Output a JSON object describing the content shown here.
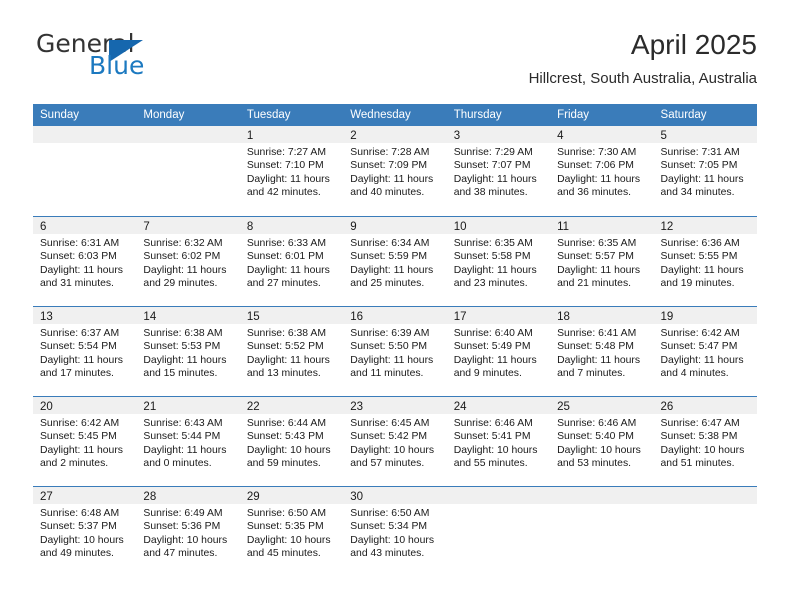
{
  "brand": {
    "name_part1": "General",
    "name_part2": "Blue",
    "triangle_icon": "triangle-icon",
    "color_primary": "#1c79c0",
    "color_dark": "#333333"
  },
  "header": {
    "title": "April 2025",
    "subtitle": "Hillcrest, South Australia, Australia"
  },
  "calendar": {
    "header_bg": "#3a7cba",
    "header_text_color": "#ffffff",
    "day_band_bg": "#f0f0f0",
    "weekdays": [
      "Sunday",
      "Monday",
      "Tuesday",
      "Wednesday",
      "Thursday",
      "Friday",
      "Saturday"
    ],
    "weeks": [
      [
        {
          "day": "",
          "empty": true
        },
        {
          "day": "",
          "empty": true
        },
        {
          "day": "1",
          "sunrise": "Sunrise: 7:27 AM",
          "sunset": "Sunset: 7:10 PM",
          "daylight_line1": "Daylight: 11 hours",
          "daylight_line2": "and 42 minutes."
        },
        {
          "day": "2",
          "sunrise": "Sunrise: 7:28 AM",
          "sunset": "Sunset: 7:09 PM",
          "daylight_line1": "Daylight: 11 hours",
          "daylight_line2": "and 40 minutes."
        },
        {
          "day": "3",
          "sunrise": "Sunrise: 7:29 AM",
          "sunset": "Sunset: 7:07 PM",
          "daylight_line1": "Daylight: 11 hours",
          "daylight_line2": "and 38 minutes."
        },
        {
          "day": "4",
          "sunrise": "Sunrise: 7:30 AM",
          "sunset": "Sunset: 7:06 PM",
          "daylight_line1": "Daylight: 11 hours",
          "daylight_line2": "and 36 minutes."
        },
        {
          "day": "5",
          "sunrise": "Sunrise: 7:31 AM",
          "sunset": "Sunset: 7:05 PM",
          "daylight_line1": "Daylight: 11 hours",
          "daylight_line2": "and 34 minutes."
        }
      ],
      [
        {
          "day": "6",
          "sunrise": "Sunrise: 6:31 AM",
          "sunset": "Sunset: 6:03 PM",
          "daylight_line1": "Daylight: 11 hours",
          "daylight_line2": "and 31 minutes."
        },
        {
          "day": "7",
          "sunrise": "Sunrise: 6:32 AM",
          "sunset": "Sunset: 6:02 PM",
          "daylight_line1": "Daylight: 11 hours",
          "daylight_line2": "and 29 minutes."
        },
        {
          "day": "8",
          "sunrise": "Sunrise: 6:33 AM",
          "sunset": "Sunset: 6:01 PM",
          "daylight_line1": "Daylight: 11 hours",
          "daylight_line2": "and 27 minutes."
        },
        {
          "day": "9",
          "sunrise": "Sunrise: 6:34 AM",
          "sunset": "Sunset: 5:59 PM",
          "daylight_line1": "Daylight: 11 hours",
          "daylight_line2": "and 25 minutes."
        },
        {
          "day": "10",
          "sunrise": "Sunrise: 6:35 AM",
          "sunset": "Sunset: 5:58 PM",
          "daylight_line1": "Daylight: 11 hours",
          "daylight_line2": "and 23 minutes."
        },
        {
          "day": "11",
          "sunrise": "Sunrise: 6:35 AM",
          "sunset": "Sunset: 5:57 PM",
          "daylight_line1": "Daylight: 11 hours",
          "daylight_line2": "and 21 minutes."
        },
        {
          "day": "12",
          "sunrise": "Sunrise: 6:36 AM",
          "sunset": "Sunset: 5:55 PM",
          "daylight_line1": "Daylight: 11 hours",
          "daylight_line2": "and 19 minutes."
        }
      ],
      [
        {
          "day": "13",
          "sunrise": "Sunrise: 6:37 AM",
          "sunset": "Sunset: 5:54 PM",
          "daylight_line1": "Daylight: 11 hours",
          "daylight_line2": "and 17 minutes."
        },
        {
          "day": "14",
          "sunrise": "Sunrise: 6:38 AM",
          "sunset": "Sunset: 5:53 PM",
          "daylight_line1": "Daylight: 11 hours",
          "daylight_line2": "and 15 minutes."
        },
        {
          "day": "15",
          "sunrise": "Sunrise: 6:38 AM",
          "sunset": "Sunset: 5:52 PM",
          "daylight_line1": "Daylight: 11 hours",
          "daylight_line2": "and 13 minutes."
        },
        {
          "day": "16",
          "sunrise": "Sunrise: 6:39 AM",
          "sunset": "Sunset: 5:50 PM",
          "daylight_line1": "Daylight: 11 hours",
          "daylight_line2": "and 11 minutes."
        },
        {
          "day": "17",
          "sunrise": "Sunrise: 6:40 AM",
          "sunset": "Sunset: 5:49 PM",
          "daylight_line1": "Daylight: 11 hours",
          "daylight_line2": "and 9 minutes."
        },
        {
          "day": "18",
          "sunrise": "Sunrise: 6:41 AM",
          "sunset": "Sunset: 5:48 PM",
          "daylight_line1": "Daylight: 11 hours",
          "daylight_line2": "and 7 minutes."
        },
        {
          "day": "19",
          "sunrise": "Sunrise: 6:42 AM",
          "sunset": "Sunset: 5:47 PM",
          "daylight_line1": "Daylight: 11 hours",
          "daylight_line2": "and 4 minutes."
        }
      ],
      [
        {
          "day": "20",
          "sunrise": "Sunrise: 6:42 AM",
          "sunset": "Sunset: 5:45 PM",
          "daylight_line1": "Daylight: 11 hours",
          "daylight_line2": "and 2 minutes."
        },
        {
          "day": "21",
          "sunrise": "Sunrise: 6:43 AM",
          "sunset": "Sunset: 5:44 PM",
          "daylight_line1": "Daylight: 11 hours",
          "daylight_line2": "and 0 minutes."
        },
        {
          "day": "22",
          "sunrise": "Sunrise: 6:44 AM",
          "sunset": "Sunset: 5:43 PM",
          "daylight_line1": "Daylight: 10 hours",
          "daylight_line2": "and 59 minutes."
        },
        {
          "day": "23",
          "sunrise": "Sunrise: 6:45 AM",
          "sunset": "Sunset: 5:42 PM",
          "daylight_line1": "Daylight: 10 hours",
          "daylight_line2": "and 57 minutes."
        },
        {
          "day": "24",
          "sunrise": "Sunrise: 6:46 AM",
          "sunset": "Sunset: 5:41 PM",
          "daylight_line1": "Daylight: 10 hours",
          "daylight_line2": "and 55 minutes."
        },
        {
          "day": "25",
          "sunrise": "Sunrise: 6:46 AM",
          "sunset": "Sunset: 5:40 PM",
          "daylight_line1": "Daylight: 10 hours",
          "daylight_line2": "and 53 minutes."
        },
        {
          "day": "26",
          "sunrise": "Sunrise: 6:47 AM",
          "sunset": "Sunset: 5:38 PM",
          "daylight_line1": "Daylight: 10 hours",
          "daylight_line2": "and 51 minutes."
        }
      ],
      [
        {
          "day": "27",
          "sunrise": "Sunrise: 6:48 AM",
          "sunset": "Sunset: 5:37 PM",
          "daylight_line1": "Daylight: 10 hours",
          "daylight_line2": "and 49 minutes."
        },
        {
          "day": "28",
          "sunrise": "Sunrise: 6:49 AM",
          "sunset": "Sunset: 5:36 PM",
          "daylight_line1": "Daylight: 10 hours",
          "daylight_line2": "and 47 minutes."
        },
        {
          "day": "29",
          "sunrise": "Sunrise: 6:50 AM",
          "sunset": "Sunset: 5:35 PM",
          "daylight_line1": "Daylight: 10 hours",
          "daylight_line2": "and 45 minutes."
        },
        {
          "day": "30",
          "sunrise": "Sunrise: 6:50 AM",
          "sunset": "Sunset: 5:34 PM",
          "daylight_line1": "Daylight: 10 hours",
          "daylight_line2": "and 43 minutes."
        },
        {
          "day": "",
          "empty": true
        },
        {
          "day": "",
          "empty": true
        },
        {
          "day": "",
          "empty": true
        }
      ]
    ]
  }
}
